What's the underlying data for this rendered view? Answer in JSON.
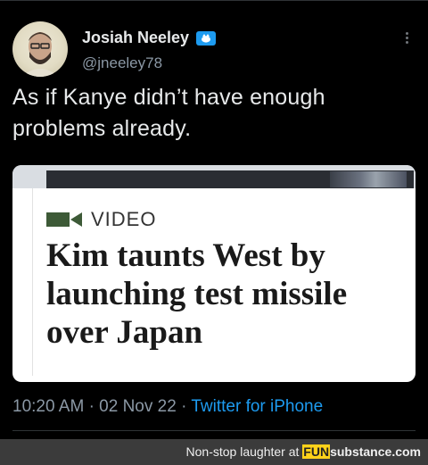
{
  "tweet": {
    "author_name": "Josiah Neeley",
    "handle": "@jneeley78",
    "text": "As if Kanye didn’t have enough problems already.",
    "time": "10:20 AM",
    "separator": "·",
    "date": "02 Nov 22",
    "app": "Twitter for iPhone"
  },
  "media": {
    "tag": "VIDEO",
    "headline": "Kim taunts West by launching test missile over Japan"
  },
  "watermark": {
    "text": "Non-stop laughter at",
    "brand_a": "FUN",
    "brand_b": "substance",
    "brand_c": ".com"
  },
  "colors": {
    "background": "#000000",
    "link": "#1d9bf0",
    "secondary_text": "#8b98a5",
    "badge": "#1d9bf0",
    "video_icon": "#3d5a37"
  },
  "icons": [
    "avatar-photo",
    "verified-badge-icon",
    "more-options-icon",
    "video-camera-icon"
  ]
}
